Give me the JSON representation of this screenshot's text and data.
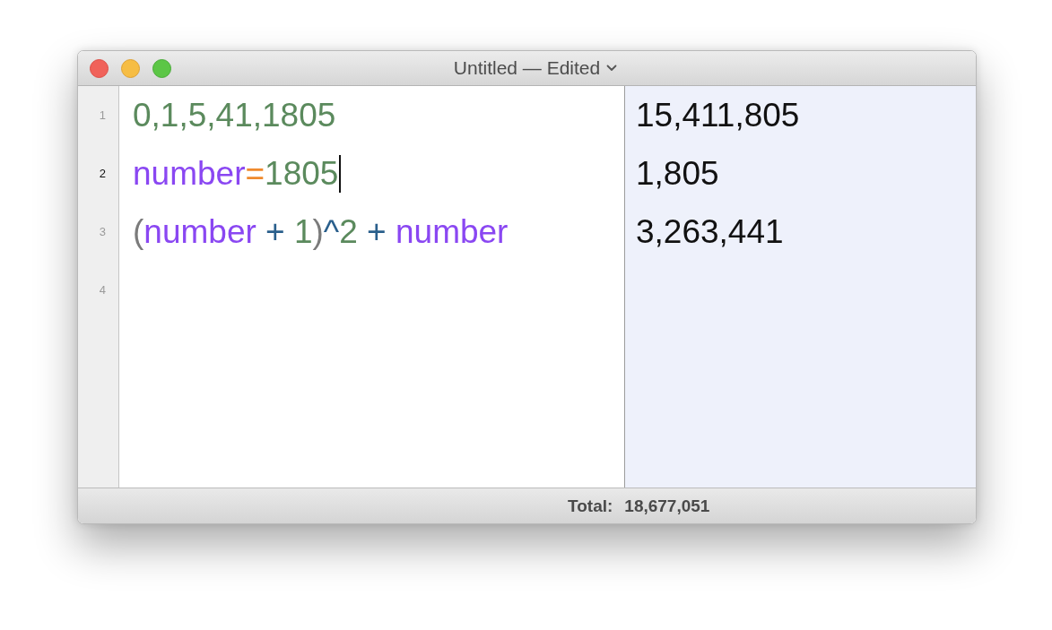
{
  "window": {
    "title": "Untitled — Edited"
  },
  "lines": [
    {
      "number": "1",
      "current": false,
      "tokens": [
        {
          "kind": "number",
          "text": "0,1,5,41,1805"
        }
      ],
      "result": "15,411,805"
    },
    {
      "number": "2",
      "current": true,
      "tokens": [
        {
          "kind": "variable",
          "text": "number"
        },
        {
          "kind": "assignment",
          "text": "="
        },
        {
          "kind": "number",
          "text": "1805"
        }
      ],
      "result": "1,805"
    },
    {
      "number": "3",
      "current": false,
      "tokens": [
        {
          "kind": "paren",
          "text": "("
        },
        {
          "kind": "variable",
          "text": "number"
        },
        {
          "kind": "operator",
          "text": " + "
        },
        {
          "kind": "number",
          "text": "1"
        },
        {
          "kind": "paren",
          "text": ")"
        },
        {
          "kind": "operator",
          "text": "^"
        },
        {
          "kind": "number",
          "text": "2"
        },
        {
          "kind": "operator",
          "text": " + "
        },
        {
          "kind": "variable",
          "text": "number"
        }
      ],
      "result": "3,263,441"
    },
    {
      "number": "4",
      "current": false
    }
  ],
  "status_bar": {
    "label": "Total:",
    "value": "18,677,051"
  }
}
